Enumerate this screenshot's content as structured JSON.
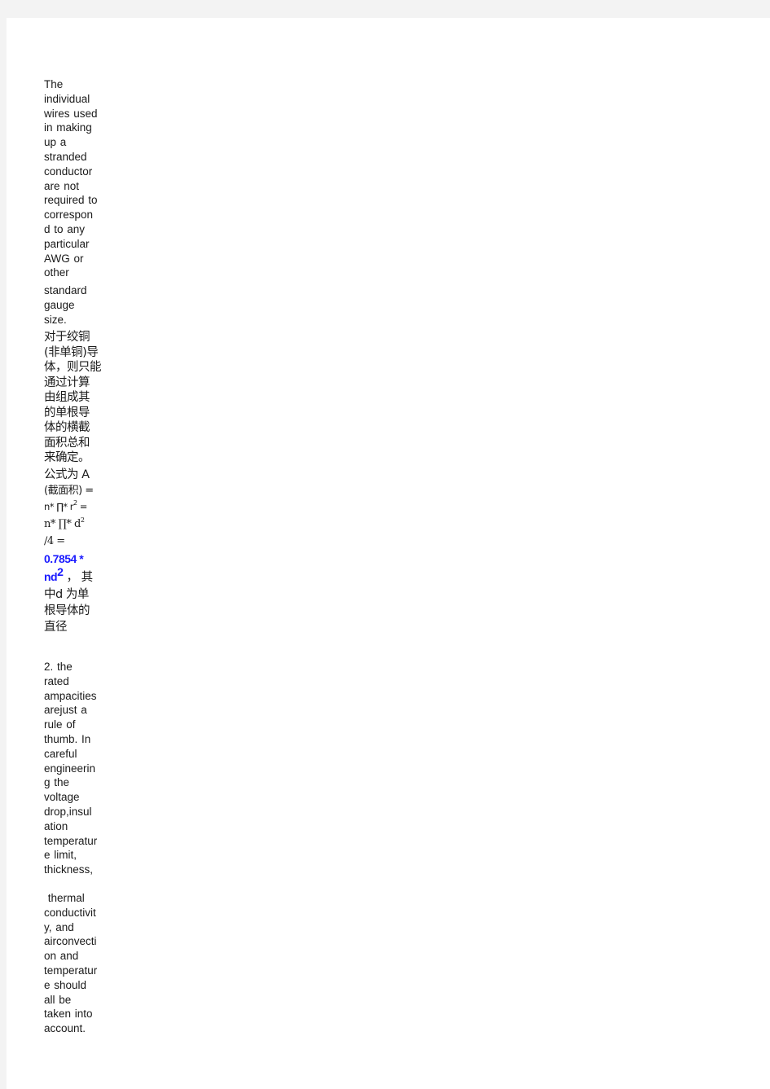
{
  "document": {
    "paragraph1_lines": [
      "The",
      "individual",
      "wires  used",
      "in  making",
      "up  a",
      "stranded",
      "conductor",
      "are  not",
      "required  to",
      "correspon",
      "d  to  any",
      "particular",
      "AWG  or",
      "other"
    ],
    "paragraph1b_lines": [
      "standard",
      "gauge",
      "size."
    ],
    "chinese_lines": [
      "对于绞铜",
      "(非单铜)导",
      "体，则只能",
      "通过计算",
      "由组成其",
      "的单根导",
      "体的横截",
      "面积总和",
      "来确定。"
    ],
    "formula": {
      "line1": "公式为 A",
      "line2": "(截面积) =",
      "line3_prefix": "n* ∏* r",
      "line3_sup": "2",
      "line3_suffix": " =",
      "line4_prefix": "n* ∏* d",
      "line4_sup": "2",
      "line5": "/4 =",
      "line6": "0.7854  *",
      "line7_prefix": "nd",
      "line7_sup": "2",
      "line7_suffix": " ， 其",
      "line8": "中d 为单",
      "line9": "根导体的",
      "line10": "直径"
    },
    "paragraph2_lines": [
      "2.  the",
      "rated",
      "ampacities",
      "arejust  a",
      "rule  of",
      "thumb.  In",
      "careful",
      "engineerin",
      "g  the",
      "voltage",
      "drop,insul",
      "ation",
      "temperatur",
      "e  limit,",
      "thickness,"
    ],
    "paragraph3_lines": [
      " thermal",
      "conductivit",
      "y,  and",
      "airconvecti",
      "on  and",
      "temperatur",
      "e  should",
      "all  be",
      "taken  into",
      "account."
    ],
    "colors": {
      "highlight_blue": "#1a1aff",
      "text": "#1a1a1a",
      "background": "#f3f3f3",
      "page": "#ffffff"
    }
  }
}
